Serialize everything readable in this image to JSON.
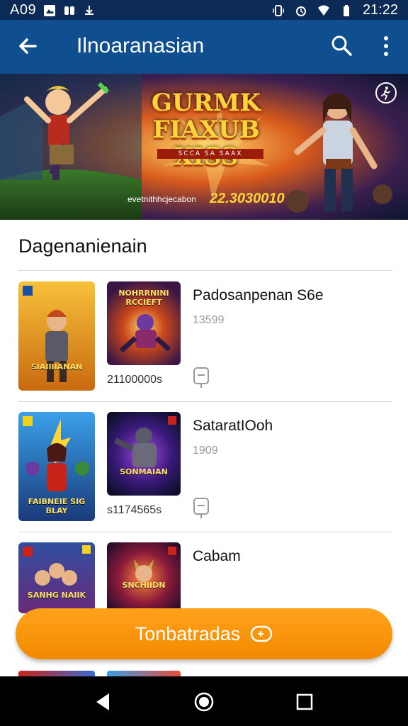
{
  "status_bar": {
    "left_text": "A09",
    "time": "21:22",
    "left_icons": [
      "gallery-icon",
      "game-icon",
      "download-icon"
    ],
    "right_icons": [
      "vibrate-icon",
      "alarm-icon",
      "wifi-icon",
      "battery-icon"
    ]
  },
  "app_bar": {
    "title": "Ilnoaranasian",
    "icons": [
      "back-arrow-icon",
      "search-icon",
      "more-vert-icon"
    ],
    "color": "#0f4f8f"
  },
  "banner": {
    "title_lines": [
      "GURMK",
      "FIAXUB",
      "XISS"
    ],
    "subtitle": "SCCA SA SAAX",
    "caption": "evetnithhcjecabon",
    "date": "22.3030010",
    "badge_icon": "running-person-icon"
  },
  "section": {
    "title": "Dagenanienain"
  },
  "games": [
    {
      "title": "Padosanpenan S6e",
      "subtitle": "13599",
      "meta": "21100000s",
      "cover_label": "SIAIIIIANAN",
      "art_label": "NOHRRNINI RCCIEFT",
      "download_icon": "download-card-icon"
    },
    {
      "title": "SataratIOoh",
      "subtitle": "1909",
      "meta": "s1174565s",
      "cover_label": "FAIBNEIE SIG BLAY",
      "art_label": "SONMAIAN",
      "download_icon": "download-card-icon"
    },
    {
      "title": "Cabam",
      "subtitle": "",
      "meta": "",
      "cover_label": "SANHG NAIIK",
      "art_label": "SNCHIIDN",
      "download_icon": "download-card-icon"
    }
  ],
  "cta": {
    "label": "Tonbatradas",
    "icon": "gamepad-icon",
    "color": "#f79400"
  },
  "nav_bar": {
    "icons": [
      "nav-back-icon",
      "nav-home-icon",
      "nav-recents-icon"
    ]
  }
}
